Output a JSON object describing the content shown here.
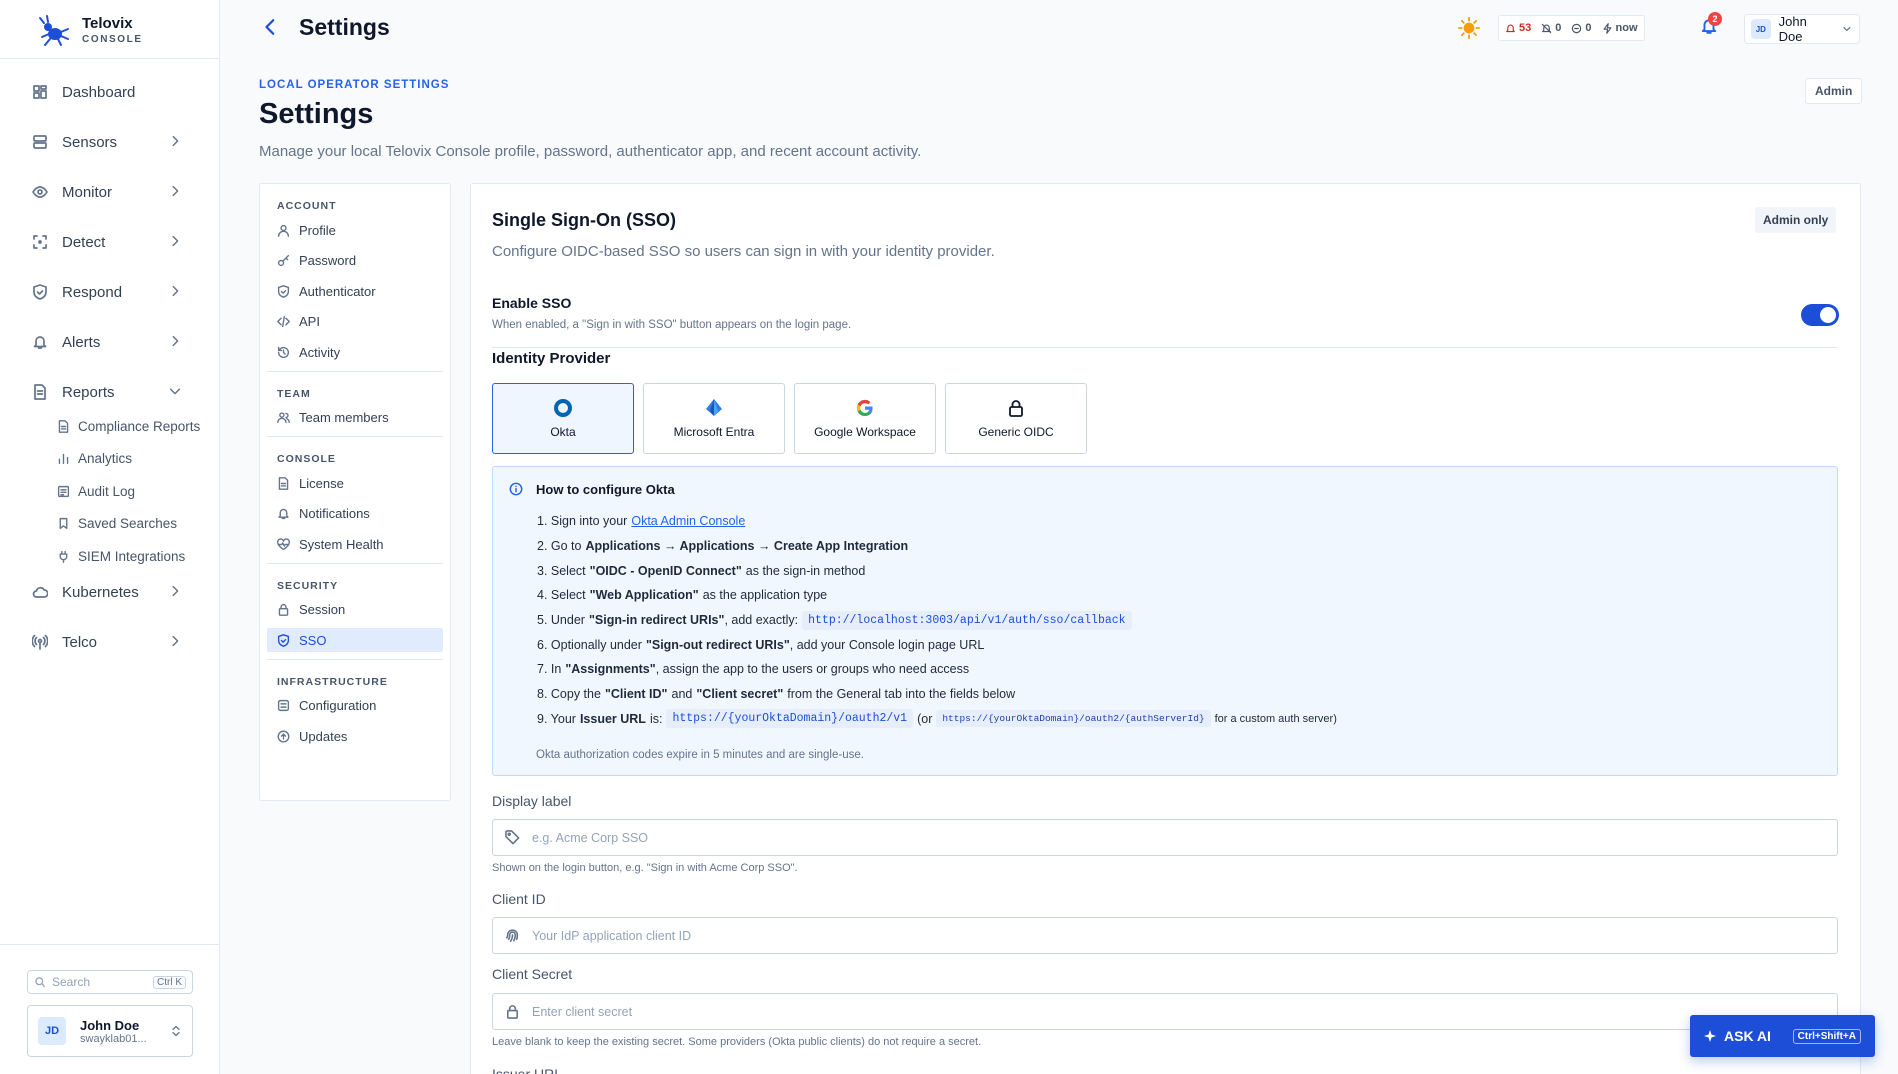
{
  "brand": {
    "name": "Telovix",
    "sub": "CONSOLE"
  },
  "sidebar": {
    "items": [
      {
        "label": "Dashboard",
        "icon": "dashboard-icon"
      },
      {
        "label": "Sensors",
        "icon": "server-icon"
      },
      {
        "label": "Monitor",
        "icon": "eye-icon"
      },
      {
        "label": "Detect",
        "icon": "scan-icon"
      },
      {
        "label": "Respond",
        "icon": "shield-icon"
      },
      {
        "label": "Alerts",
        "icon": "bell-icon"
      },
      {
        "label": "Reports",
        "icon": "file-icon"
      },
      {
        "label": "Kubernetes",
        "icon": "cloud-icon"
      },
      {
        "label": "Telco",
        "icon": "antenna-icon"
      }
    ],
    "reports_sub": [
      {
        "label": "Compliance Reports",
        "icon": "document-icon"
      },
      {
        "label": "Analytics",
        "icon": "bar-chart-icon"
      },
      {
        "label": "Audit Log",
        "icon": "log-icon"
      },
      {
        "label": "Saved Searches",
        "icon": "bookmark-icon"
      },
      {
        "label": "SIEM Integrations",
        "icon": "plug-icon"
      }
    ],
    "search_placeholder": "Search",
    "search_shortcut": "Ctrl K",
    "user": {
      "initials": "JD",
      "name": "John Doe",
      "email": "swayklab01..."
    }
  },
  "header": {
    "title": "Settings",
    "stats": {
      "alerts": "53",
      "muted": "0",
      "blocked": "0",
      "updated": "now"
    },
    "notifications": "2",
    "user": {
      "initials": "JD",
      "name": "John Doe"
    }
  },
  "page": {
    "eyebrow": "LOCAL OPERATOR SETTINGS",
    "title": "Settings",
    "subtitle": "Manage your local Telovix Console profile, password, authenticator app, and recent account activity.",
    "role": "Admin"
  },
  "settings_nav": {
    "account": {
      "title": "ACCOUNT",
      "items": [
        "Profile",
        "Password",
        "Authenticator",
        "API",
        "Activity"
      ]
    },
    "team": {
      "title": "TEAM",
      "items": [
        "Team members"
      ]
    },
    "console": {
      "title": "CONSOLE",
      "items": [
        "License",
        "Notifications",
        "System Health"
      ]
    },
    "security": {
      "title": "SECURITY",
      "items": [
        "Session",
        "SSO"
      ]
    },
    "infra": {
      "title": "INFRASTRUCTURE",
      "items": [
        "Configuration",
        "Updates"
      ]
    }
  },
  "sso": {
    "title": "Single Sign-On (SSO)",
    "subtitle": "Configure OIDC-based SSO so users can sign in with your identity provider.",
    "badge": "Admin only",
    "enable_label": "Enable SSO",
    "enable_help": "When enabled, a \"Sign in with SSO\" button appears on the login page.",
    "enabled": true,
    "idp_title": "Identity Provider",
    "providers": [
      "Okta",
      "Microsoft Entra",
      "Google Workspace",
      "Generic OIDC"
    ],
    "selected_provider": "Okta",
    "howto": {
      "title": "How to configure Okta",
      "s1_pre": "1. Sign into your",
      "s1_link": "Okta Admin Console",
      "s2_pre": "2. Go to",
      "s2_b": "Applications → Applications → Create App Integration",
      "s3_pre": "3. Select",
      "s3_b": "\"OIDC - OpenID Connect\"",
      "s3_post": "as the sign-in method",
      "s4_pre": "4. Select",
      "s4_b": "\"Web Application\"",
      "s4_post": "as the application type",
      "s5_pre": "5. Under",
      "s5_b": "\"Sign-in redirect URIs\"",
      "s5_post": ", add exactly:",
      "s5_code": "http://localhost:3003/api/v1/auth/sso/callback",
      "s6_pre": "6. Optionally under",
      "s6_b": "\"Sign-out redirect URIs\"",
      "s6_post": ", add your Console login page URL",
      "s7_pre": "7. In",
      "s7_b": "\"Assignments\"",
      "s7_post": ", assign the app to the users or groups who need access",
      "s8_pre": "8. Copy the",
      "s8_b1": "\"Client ID\"",
      "s8_mid": "and",
      "s8_b2": "\"Client secret\"",
      "s8_post": "from the General tab into the fields below",
      "s9_pre": "9. Your",
      "s9_b": "Issuer URL",
      "s9_mid": "is:",
      "s9_code": "https://{yourOktaDomain}/oauth2/v1",
      "s9_or": "(or",
      "s9_code2": "https://{yourOktaDomain}/oauth2/{authServerId}",
      "s9_post": "for a custom auth server)",
      "note": "Okta authorization codes expire in 5 minutes and are single-use."
    },
    "display_label": {
      "label": "Display label",
      "placeholder": "e.g. Acme Corp SSO",
      "help": "Shown on the login button, e.g. \"Sign in with Acme Corp SSO\"."
    },
    "client_id": {
      "label": "Client ID",
      "placeholder": "Your IdP application client ID"
    },
    "client_secret": {
      "label": "Client Secret",
      "placeholder": "Enter client secret",
      "help": "Leave blank to keep the existing secret. Some providers (Okta public clients) do not require a secret."
    },
    "issuer": {
      "label": "Issuer URL"
    }
  },
  "ask_ai": {
    "label": "ASK AI",
    "shortcut": "Ctrl+Shift+A"
  },
  "colors": {
    "accent": "#1d4ed8",
    "danger": "#ef4444",
    "warning": "#f59e0b"
  }
}
